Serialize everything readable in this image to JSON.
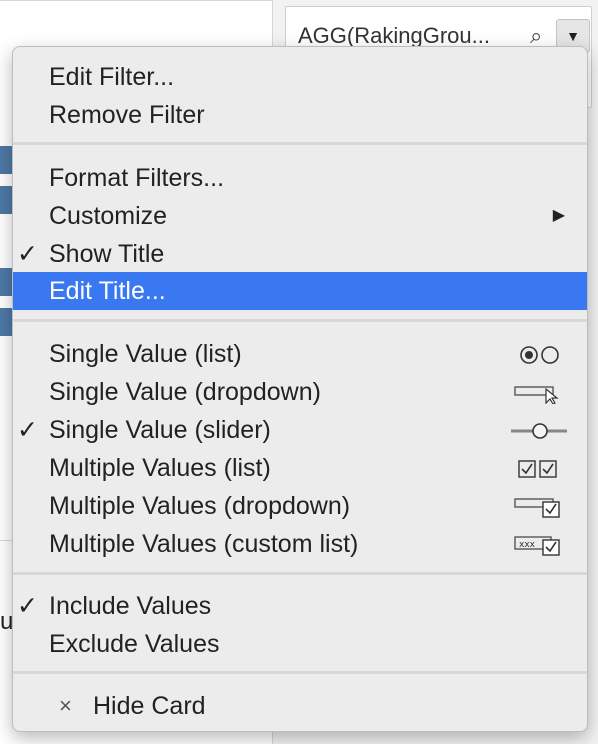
{
  "filter_card": {
    "title": "AGG(RakingGrou...",
    "search_icon": "search-icon",
    "dropdown_icon": "chevron-down-icon"
  },
  "background": {
    "cut_text": "ua",
    "bar_color": "#4e79a7"
  },
  "menu": {
    "section1": {
      "edit_filter": "Edit Filter...",
      "remove_filter": "Remove Filter"
    },
    "section2": {
      "format_filters": "Format Filters...",
      "customize": "Customize",
      "show_title": "Show Title",
      "edit_title": "Edit Title..."
    },
    "section3": {
      "single_list": "Single Value (list)",
      "single_dropdown": "Single Value (dropdown)",
      "single_slider": "Single Value (slider)",
      "multi_list": "Multiple Values (list)",
      "multi_dropdown": "Multiple Values (dropdown)",
      "multi_custom": "Multiple Values (custom list)"
    },
    "section4": {
      "include_values": "Include Values",
      "exclude_values": "Exclude Values"
    },
    "section5": {
      "hide_card": "Hide Card"
    },
    "check_glyph": "✓",
    "submenu_glyph": "▶",
    "hide_glyph": "×",
    "highlight_color": "#3a78f2"
  }
}
